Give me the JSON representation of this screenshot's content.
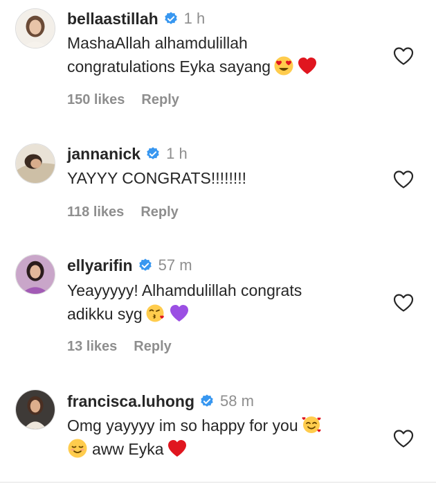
{
  "colors": {
    "verified_badge": "#3897f0",
    "text_primary": "#262626",
    "text_secondary": "#8e8e8e",
    "heart_outline": "#262626",
    "emoji_red_heart": "#e0161f",
    "emoji_purple_heart": "#9b4fe3"
  },
  "comments": [
    {
      "username": "bellaastillah",
      "verified": true,
      "time": "1 h",
      "text_line1": "MashaAllah alhamdulillah",
      "text_line2": "congratulations Eyka sayang",
      "emojis": [
        "heart-eyes-emoji",
        "red-heart-emoji"
      ],
      "likes": "150 likes",
      "reply": "Reply"
    },
    {
      "username": "jannanick",
      "verified": true,
      "time": "1 h",
      "text_line1": "YAYYY CONGRATS!!!!!!!!",
      "likes": "118 likes",
      "reply": "Reply"
    },
    {
      "username": "ellyarifin",
      "verified": true,
      "time": "57 m",
      "text_line1": "Yeayyyyy! Alhamdulillah congrats",
      "text_line2": "adikku syg",
      "emojis": [
        "kissing-heart-emoji",
        "purple-heart-emoji"
      ],
      "likes": "13 likes",
      "reply": "Reply"
    },
    {
      "username": "francisca.luhong",
      "verified": true,
      "time": "58 m",
      "text_line1": "Omg yayyyy im so happy for you",
      "text_line2": "aww Eyka",
      "emojis": [
        "smiling-hearts-emoji",
        "relieved-smile-emoji",
        "red-heart-emoji"
      ]
    }
  ]
}
